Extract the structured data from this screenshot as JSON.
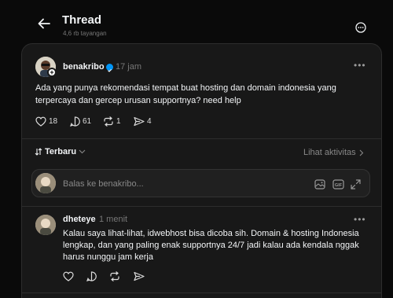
{
  "header": {
    "title": "Thread",
    "views": "4,6 rb tayangan"
  },
  "post": {
    "author": "benakribo",
    "time": "17 jam",
    "text_line1": "Ada yang punya rekomendasi tempat buat hosting dan domain indonesia yang",
    "text_line2": "terpercaya dan gercep urusan supportnya? need help",
    "likes": "18",
    "replies": "61",
    "reposts": "1",
    "shares": "4"
  },
  "sort": {
    "label": "Terbaru",
    "activity": "Lihat aktivitas"
  },
  "reply_box": {
    "placeholder": "Balas ke benakribo..."
  },
  "reply": {
    "author": "dheteye",
    "time": "1 menit",
    "text_line1": "Kalau saya lihat-lihat, idwebhost bisa dicoba sih. Domain & hosting Indonesia",
    "text_line2": "lengkap, dan yang paling enak supportnya 24/7 jadi kalau ada kendala nggak",
    "text_line3": "harus nunggu jam kerja"
  },
  "colors": {
    "background": "#0a0a0a",
    "card": "#181818",
    "verified": "#0095f6"
  },
  "icons": [
    "back-arrow-icon",
    "more-circle-icon",
    "verified-icon",
    "heart-icon",
    "comment-icon",
    "repost-icon",
    "share-icon",
    "sort-icon",
    "chevron-down-icon",
    "chevron-right-icon",
    "image-icon",
    "gif-icon",
    "expand-icon",
    "more-icon"
  ]
}
